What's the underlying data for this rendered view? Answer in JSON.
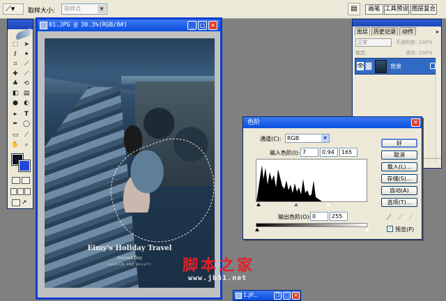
{
  "options_bar": {
    "sample_size_label": "取样大小:",
    "sample_size_value": "取样点",
    "tabs": [
      "画笔",
      "工具预设",
      "图层复合"
    ]
  },
  "document": {
    "title": "01.JPG @ 30.3%(RGB/8#)",
    "photo_caption_title": "Eimy's Holiday Travel",
    "photo_caption_subtitle": "Second Day",
    "photo_caption_small": "FASHION AND BEAUTY"
  },
  "layers_panel": {
    "tabs": [
      "图层",
      "历史记录",
      "动作"
    ],
    "blend_mode": "正常",
    "opacity_label": "不透明度: 100%",
    "lock_label": "锁定:",
    "fill_label": "填充: 100%",
    "layer_name": "背景"
  },
  "levels_dialog": {
    "title": "色阶",
    "channel_label": "通道(C):",
    "channel_value": "RGB",
    "input_label": "输入色阶(I):",
    "input_black": "7",
    "input_gamma": "0.94",
    "input_white": "165",
    "output_label": "输出色阶(O):",
    "output_black": "0",
    "output_white": "255",
    "buttons": {
      "ok": "好",
      "cancel": "取消",
      "load": "载入(L)...",
      "save": "存储(S)...",
      "auto": "自动(A)",
      "options": "选项(T)..."
    },
    "preview_label": "预览(P)",
    "preview_checked": true
  },
  "minimized_window": {
    "title": "1.JP..."
  },
  "watermark": {
    "chinese": "脚本之家",
    "url": "www.jb51.net"
  },
  "colors": {
    "foreground": "#0b1322",
    "background": "#2348d8",
    "titlebar": "#0b4fe0"
  }
}
